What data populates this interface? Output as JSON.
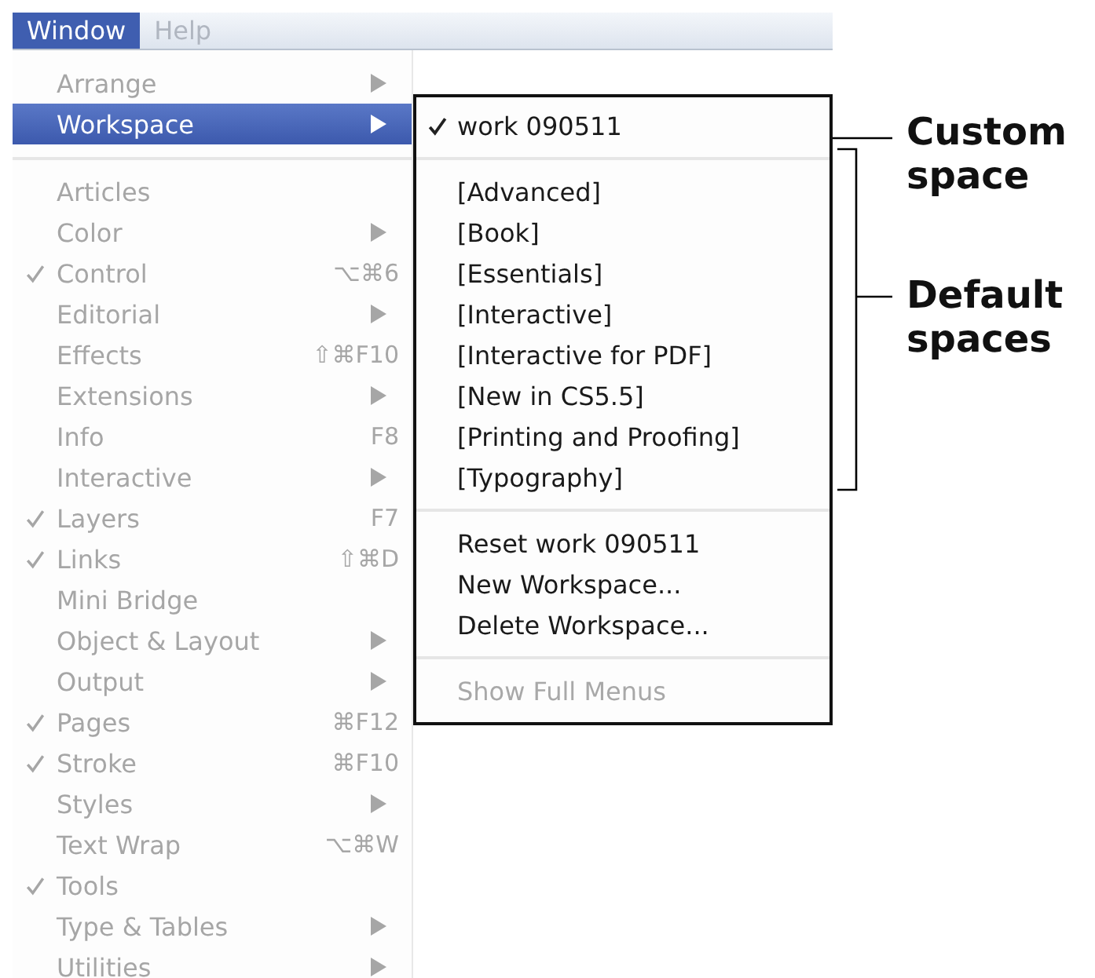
{
  "menubar": [
    {
      "label": "Window",
      "selected": true
    },
    {
      "label": "Help",
      "selected": false
    }
  ],
  "menu": {
    "items": [
      {
        "kind": "item",
        "label": "Arrange",
        "checked": false,
        "submenu": true,
        "selected": false,
        "disabled": true
      },
      {
        "kind": "item",
        "label": "Workspace",
        "checked": false,
        "submenu": true,
        "selected": true,
        "disabled": false
      },
      {
        "kind": "separator"
      },
      {
        "kind": "item",
        "label": "Articles",
        "checked": false,
        "submenu": false,
        "selected": false,
        "disabled": true
      },
      {
        "kind": "item",
        "label": "Color",
        "checked": false,
        "submenu": true,
        "selected": false,
        "disabled": true
      },
      {
        "kind": "item",
        "label": "Control",
        "checked": true,
        "shortcut": "⌥⌘6",
        "submenu": false,
        "selected": false,
        "disabled": true
      },
      {
        "kind": "item",
        "label": "Editorial",
        "checked": false,
        "submenu": true,
        "selected": false,
        "disabled": true
      },
      {
        "kind": "item",
        "label": "Effects",
        "checked": false,
        "shortcut": "⇧⌘F10",
        "submenu": false,
        "selected": false,
        "disabled": true
      },
      {
        "kind": "item",
        "label": "Extensions",
        "checked": false,
        "submenu": true,
        "selected": false,
        "disabled": true
      },
      {
        "kind": "item",
        "label": "Info",
        "checked": false,
        "shortcut": "F8",
        "submenu": false,
        "selected": false,
        "disabled": true
      },
      {
        "kind": "item",
        "label": "Interactive",
        "checked": false,
        "submenu": true,
        "selected": false,
        "disabled": true
      },
      {
        "kind": "item",
        "label": "Layers",
        "checked": true,
        "shortcut": "F7",
        "submenu": false,
        "selected": false,
        "disabled": true
      },
      {
        "kind": "item",
        "label": "Links",
        "checked": true,
        "shortcut": "⇧⌘D",
        "submenu": false,
        "selected": false,
        "disabled": true
      },
      {
        "kind": "item",
        "label": "Mini Bridge",
        "checked": false,
        "submenu": false,
        "selected": false,
        "disabled": true
      },
      {
        "kind": "item",
        "label": "Object & Layout",
        "checked": false,
        "submenu": true,
        "selected": false,
        "disabled": true
      },
      {
        "kind": "item",
        "label": "Output",
        "checked": false,
        "submenu": true,
        "selected": false,
        "disabled": true
      },
      {
        "kind": "item",
        "label": "Pages",
        "checked": true,
        "shortcut": "⌘F12",
        "submenu": false,
        "selected": false,
        "disabled": true
      },
      {
        "kind": "item",
        "label": "Stroke",
        "checked": true,
        "shortcut": "⌘F10",
        "submenu": false,
        "selected": false,
        "disabled": true
      },
      {
        "kind": "item",
        "label": "Styles",
        "checked": false,
        "submenu": true,
        "selected": false,
        "disabled": true
      },
      {
        "kind": "item",
        "label": "Text Wrap",
        "checked": false,
        "shortcut": "⌥⌘W",
        "submenu": false,
        "selected": false,
        "disabled": true
      },
      {
        "kind": "item",
        "label": "Tools",
        "checked": true,
        "submenu": false,
        "selected": false,
        "disabled": true
      },
      {
        "kind": "item",
        "label": "Type & Tables",
        "checked": false,
        "submenu": true,
        "selected": false,
        "disabled": true
      },
      {
        "kind": "item",
        "label": "Utilities",
        "checked": false,
        "submenu": true,
        "selected": false,
        "disabled": true
      }
    ]
  },
  "workspace_submenu": {
    "items": [
      {
        "kind": "item",
        "label": "work 090511",
        "checked": true,
        "disabled": false
      },
      {
        "kind": "separator"
      },
      {
        "kind": "item",
        "label": "[Advanced]",
        "checked": false,
        "disabled": false
      },
      {
        "kind": "item",
        "label": "[Book]",
        "checked": false,
        "disabled": false
      },
      {
        "kind": "item",
        "label": "[Essentials]",
        "checked": false,
        "disabled": false
      },
      {
        "kind": "item",
        "label": "[Interactive]",
        "checked": false,
        "disabled": false
      },
      {
        "kind": "item",
        "label": "[Interactive for PDF]",
        "checked": false,
        "disabled": false
      },
      {
        "kind": "item",
        "label": "[New in CS5.5]",
        "checked": false,
        "disabled": false
      },
      {
        "kind": "item",
        "label": "[Printing and Proofing]",
        "checked": false,
        "disabled": false
      },
      {
        "kind": "item",
        "label": "[Typography]",
        "checked": false,
        "disabled": false
      },
      {
        "kind": "separator"
      },
      {
        "kind": "item",
        "label": "Reset work 090511",
        "checked": false,
        "disabled": false
      },
      {
        "kind": "item",
        "label": "New Workspace...",
        "checked": false,
        "disabled": false
      },
      {
        "kind": "item",
        "label": "Delete Workspace...",
        "checked": false,
        "disabled": false
      },
      {
        "kind": "separator"
      },
      {
        "kind": "item",
        "label": "Show Full Menus",
        "checked": false,
        "disabled": true
      }
    ]
  },
  "callouts": [
    {
      "kind": "line",
      "label": "Custom space"
    },
    {
      "kind": "bracket",
      "label": "Default spaces"
    }
  ]
}
